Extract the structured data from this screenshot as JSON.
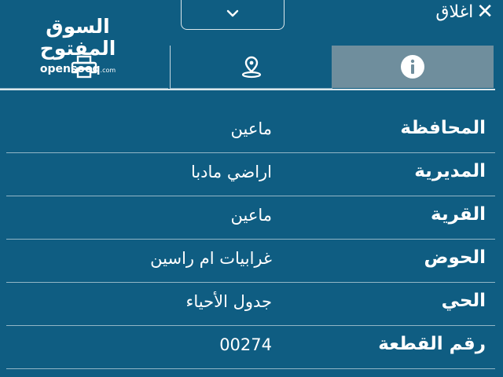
{
  "header": {
    "close_label": "اغلاق",
    "logo_arabic": "السوق المفتوح",
    "logo_domain": "opensooq",
    "logo_tld": ".com"
  },
  "tabs": [
    {
      "name": "print",
      "icon": "printer-icon"
    },
    {
      "name": "location",
      "icon": "location-pin-icon"
    },
    {
      "name": "info",
      "icon": "info-icon",
      "active": true
    }
  ],
  "colors": {
    "background": "#0f5d82",
    "active_tab": "#6f8e9d",
    "text": "#ffffff"
  },
  "details": [
    {
      "label": "المحافظة",
      "value": "ماعين"
    },
    {
      "label": "المديرية",
      "value": "اراضي مادبا"
    },
    {
      "label": "القرية",
      "value": "ماعين"
    },
    {
      "label": "الحوض",
      "value": "غرابيات ام راسين"
    },
    {
      "label": "الحي",
      "value": "جدول الأحياء"
    },
    {
      "label": "رقم القطعة",
      "value": "00274"
    }
  ]
}
